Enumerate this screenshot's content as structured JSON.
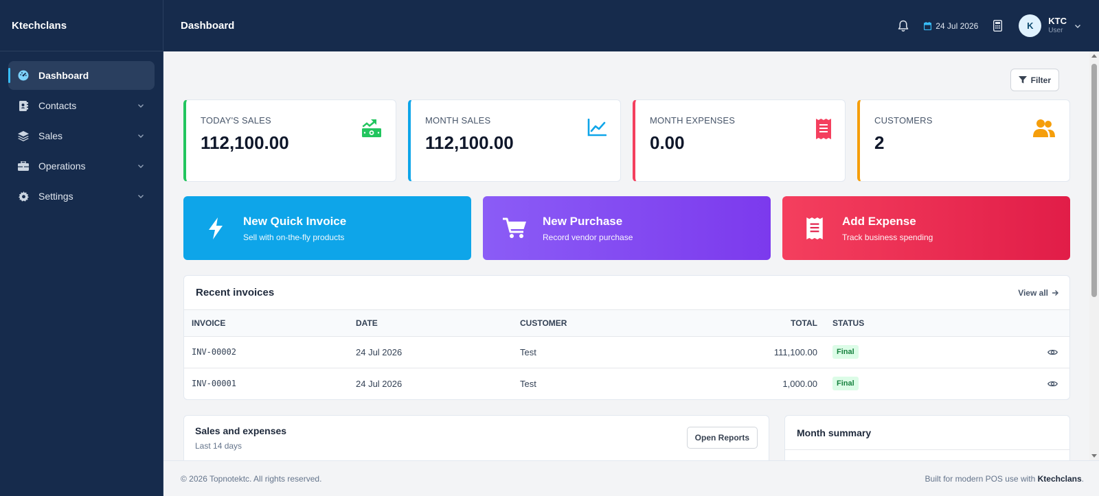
{
  "app": {
    "brand": "Ktechclans"
  },
  "sidebar": {
    "items": [
      {
        "label": "Dashboard",
        "icon": "gauge-icon"
      },
      {
        "label": "Contacts",
        "icon": "address-book-icon"
      },
      {
        "label": "Sales",
        "icon": "layers-icon"
      },
      {
        "label": "Operations",
        "icon": "briefcase-icon"
      },
      {
        "label": "Settings",
        "icon": "gear-icon"
      }
    ]
  },
  "header": {
    "title": "Dashboard",
    "date": "24 Jul 2026",
    "user": {
      "initial": "K",
      "name": "KTC",
      "role": "User"
    }
  },
  "toolbar": {
    "filter_label": "Filter"
  },
  "stats": [
    {
      "label": "TODAY'S SALES",
      "value": "112,100.00",
      "color": "#22c55e",
      "icon": "money-growth-icon"
    },
    {
      "label": "MONTH SALES",
      "value": "112,100.00",
      "color": "#0ea5e9",
      "icon": "line-chart-icon"
    },
    {
      "label": "MONTH EXPENSES",
      "value": "0.00",
      "color": "#f43f5e",
      "icon": "receipt-icon"
    },
    {
      "label": "CUSTOMERS",
      "value": "2",
      "color": "#f59e0b",
      "icon": "users-icon"
    }
  ],
  "actions": [
    {
      "title": "New Quick Invoice",
      "subtitle": "Sell with on-the-fly products",
      "icon": "bolt-icon"
    },
    {
      "title": "New Purchase",
      "subtitle": "Record vendor purchase",
      "icon": "cart-icon"
    },
    {
      "title": "Add Expense",
      "subtitle": "Track business spending",
      "icon": "receipt-icon"
    }
  ],
  "invoices": {
    "title": "Recent invoices",
    "view_all": "View all",
    "columns": [
      "INVOICE",
      "DATE",
      "CUSTOMER",
      "TOTAL",
      "STATUS"
    ],
    "rows": [
      {
        "invoice": "INV-00002",
        "date": "24 Jul 2026",
        "customer": "Test",
        "total": "111,100.00",
        "status": "Final"
      },
      {
        "invoice": "INV-00001",
        "date": "24 Jul 2026",
        "customer": "Test",
        "total": "1,000.00",
        "status": "Final"
      }
    ]
  },
  "chart_card": {
    "title": "Sales and expenses",
    "subtitle": "Last 14 days",
    "button": "Open Reports"
  },
  "summary_card": {
    "title": "Month summary"
  },
  "footer": {
    "copyright": "© 2026 Topnotektc. All rights reserved.",
    "tagline_prefix": "Built for modern POS use with",
    "tagline_brand": "Ktechclans",
    "tagline_suffix": "."
  }
}
